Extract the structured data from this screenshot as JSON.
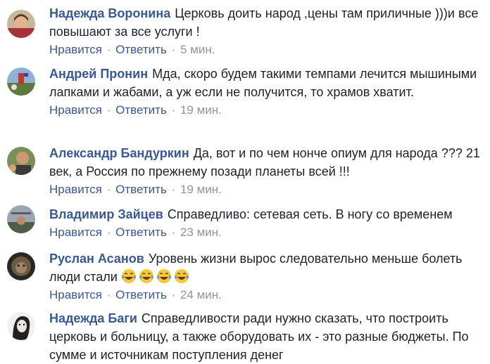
{
  "comments": [
    {
      "author": "Надежда Воронина",
      "text": "Церковь доить народ ,цены там приличные )))и все повышают за все услуги !",
      "like": "Нравится",
      "reply": "Ответить",
      "time": "5 мин."
    },
    {
      "author": "Андрей Пронин",
      "text": "Мда, скоро будем такими темпами лечится мышиными лапками и жабами, а уж если не получится, то храмов хватит.",
      "like": "Нравится",
      "reply": "Ответить",
      "time": "19 мин."
    },
    {
      "author": "Александр Бандуркин",
      "text": "Да, вот и по чем нонче опиум для народа ??? 21 век, а Россия по прежнему позади планеты всей !!!",
      "like": "Нравится",
      "reply": "Ответить",
      "time": "19 мин."
    },
    {
      "author": "Владимир Зайцев",
      "text": "Справедливо: сетевая сеть. В ногу со временем",
      "like": "Нравится",
      "reply": "Ответить",
      "time": "23 мин."
    },
    {
      "author": "Руслан Асанов",
      "text": "Уровень жизни вырос следовательно меньше болеть люди стали",
      "like": "Нравится",
      "reply": "Ответить",
      "time": "24 мин.",
      "emoji": [
        "laughing-tears-icon",
        "laughing-tears-icon",
        "laughing-tears-icon",
        "laughing-tears-icon"
      ]
    },
    {
      "author": "Надежда Баги",
      "text": "Справедливости ради нужно сказать, что построить церковь и больницу, а также оборудовать их - это разные бюджеты. По сумме и источникам поступления денег"
    }
  ],
  "separator": "·",
  "colors": {
    "author": "#385898",
    "text": "#1d2129",
    "meta": "#90949c"
  }
}
